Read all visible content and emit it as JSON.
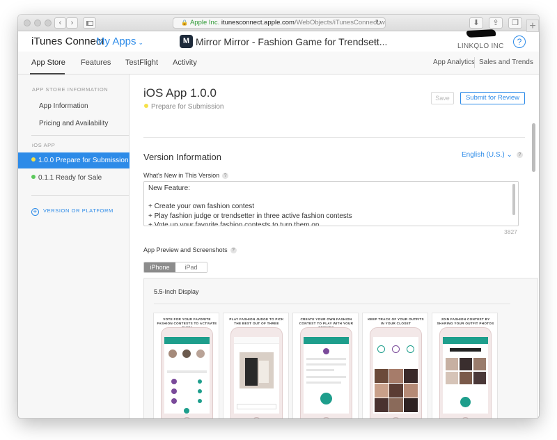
{
  "browser": {
    "address": {
      "org": "Apple Inc.",
      "host": "itunesconnect.apple.com",
      "path": "/WebObjects/iTunesConnect.woa/ra/"
    }
  },
  "header": {
    "brand": "iTunes Connect",
    "my_apps": "My Apps",
    "app_title": "Mirror Mirror - Fashion Game for Trendsett...",
    "app_icon_letter": "M",
    "org_name": "LINKQLO INC",
    "help": "?"
  },
  "nav": {
    "tabs": [
      "App Store",
      "Features",
      "TestFlight",
      "Activity"
    ],
    "right": [
      "App Analytics",
      "Sales and Trends"
    ]
  },
  "sidebar": {
    "section1": "APP STORE INFORMATION",
    "items": [
      "App Information",
      "Pricing and Availability"
    ],
    "section2": "iOS APP",
    "versions": [
      {
        "label": "1.0.0 Prepare for Submission",
        "dot": "#f5e14a"
      },
      {
        "label": "0.1.1 Ready for Sale",
        "dot": "#5cc95c"
      }
    ],
    "add_label": "VERSION OR PLATFORM"
  },
  "main": {
    "title": "iOS App 1.0.0",
    "status": "Prepare for Submission",
    "status_dot": "#f5e14a",
    "save": "Save",
    "submit": "Submit for Review",
    "section_title": "Version Information",
    "language": "English (U.S.)",
    "whats_new_label": "What's New in This Version",
    "whats_new_text": "New Feature:\n\n+ Create your own fashion contest\n+ Play fashion judge or trendsetter in three active fashion contests\n+ Vote up your favorite fashion contests to turn them on",
    "char_count": "3827",
    "preview_label": "App Preview and Screenshots",
    "device_tabs": [
      "iPhone",
      "iPad"
    ],
    "display_title": "5.5-Inch Display",
    "screenshots": [
      {
        "caption": "VOTE FOR YOUR FAVORITE FASHION CONTESTS TO ACTIVATE THEM"
      },
      {
        "caption": "PLAY FASHION JUDGE TO PICK THE BEST OUT OF THREE"
      },
      {
        "caption": "CREATE YOUR OWN FASHION CONTEST TO PLAY WITH YOUR FRIENDS"
      },
      {
        "caption": "KEEP TRACK OF YOUR OUTFITS IN YOUR CLOSET"
      },
      {
        "caption": "JOIN FASHION CONTEST BY SHARING YOUR OUTFIT PHOTOS"
      }
    ]
  },
  "colors": {
    "accent": "#2d8be8",
    "selected_bg": "#2d8be8",
    "teal": "#1e9e8c"
  }
}
